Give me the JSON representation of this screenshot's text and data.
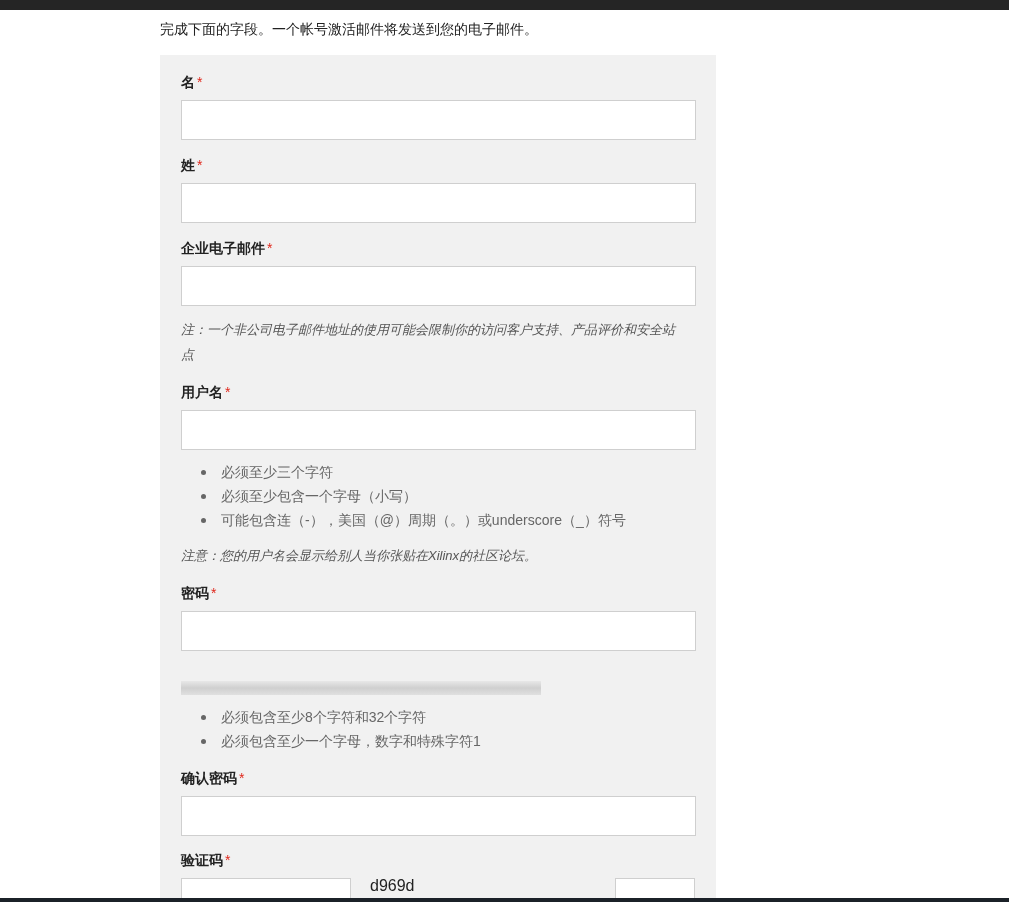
{
  "intro": "完成下面的字段。一个帐号激活邮件将发送到您的电子邮件。",
  "form": [
    {
      "kind": "field",
      "label": "名",
      "required_mark": "*"
    },
    {
      "kind": "field",
      "label": "姓",
      "required_mark": "*"
    },
    {
      "kind": "field",
      "label": "企业电子邮件",
      "required_mark": "*"
    },
    {
      "kind": "note",
      "text": "注：一个非公司电子邮件地址的使用可能会限制你的访问客户支持、产品评价和安全站点"
    },
    {
      "kind": "field",
      "label": "用户名",
      "required_mark": "*"
    },
    {
      "kind": "bullets",
      "items": [
        "必须至少三个字符",
        "必须至少包含一个字母（小写）",
        "可能包含连（-），美国（@）周期（。）或underscore（_）符号"
      ]
    },
    {
      "kind": "note",
      "text": "注意：您的用户名会显示给别人当你张贴在Xilinx的社区论坛。"
    },
    {
      "kind": "field",
      "label": "密码",
      "required_mark": "*"
    },
    {
      "kind": "meter",
      "level": 0
    },
    {
      "kind": "bullets",
      "items": [
        "必须包含至少8个字符和32个字符",
        "必须包含至少一个字母，数字和特殊字符1"
      ]
    },
    {
      "kind": "field",
      "label": "确认密码",
      "required_mark": "*"
    },
    {
      "kind": "captcha",
      "label": "验证码",
      "required_mark": "*",
      "code": "d969d"
    }
  ]
}
